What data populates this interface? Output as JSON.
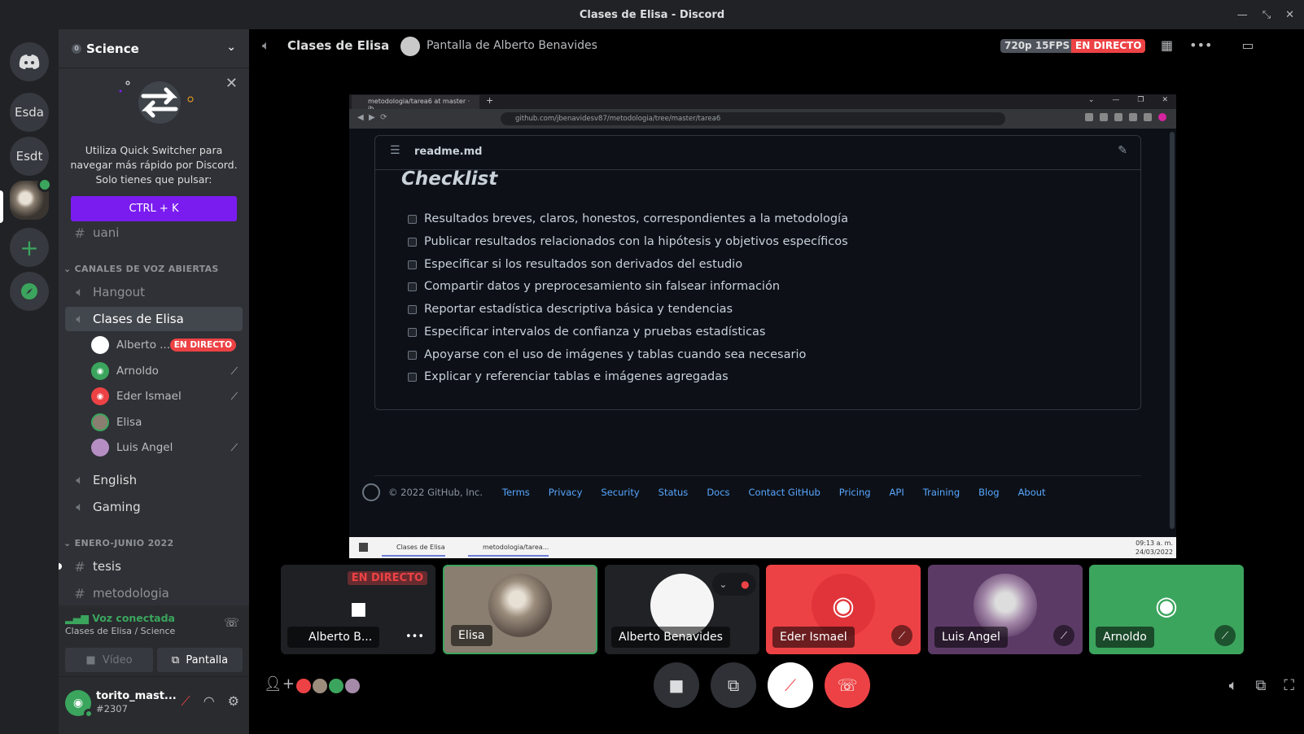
{
  "window": {
    "title": "Clases de Elisa - Discord"
  },
  "guilds": [
    {
      "label": "Esda"
    },
    {
      "label": "Esdt"
    }
  ],
  "server": {
    "name": "Science",
    "pin_count": "0"
  },
  "quick_switcher": {
    "text": "Utiliza Quick Switcher para navegar más rápido por Discord. Solo tienes que pulsar:",
    "button": "CTRL + K"
  },
  "channels": {
    "partial_top": "uani",
    "voice_category": "CANALES DE VOZ ABIERTAS",
    "voice": [
      {
        "name": "Hangout"
      },
      {
        "name": "Clases de Elisa"
      },
      {
        "name": "English"
      },
      {
        "name": "Gaming"
      }
    ],
    "voice_users": [
      {
        "name": "Alberto ...",
        "live": "EN DIRECTO"
      },
      {
        "name": "Arnoldo"
      },
      {
        "name": "Eder Ismael"
      },
      {
        "name": "Elisa"
      },
      {
        "name": "Luis Angel"
      }
    ],
    "text_category": "ENERO-JUNIO 2022",
    "text": [
      {
        "name": "tesis"
      },
      {
        "name": "metodologia"
      }
    ]
  },
  "voice_panel": {
    "status": "Voz conectada",
    "location": "Clases de Elisa / Science",
    "video": "Vídeo",
    "screen": "Pantalla"
  },
  "user": {
    "name": "torito_mast...",
    "tag": "#2307"
  },
  "header": {
    "channel": "Clases de Elisa",
    "screen_owner": "Pantalla de Alberto Benavides",
    "quality": "720p 15FPS",
    "live": "EN DIRECTO"
  },
  "stream": {
    "browser_tab": "metodologia/tarea6 at master · jb",
    "url": "github.com/jbenavidesv87/metodologia/tree/master/tarea6",
    "file_name": "readme.md",
    "heading": "Checklist",
    "checklist": [
      "Resultados breves, claros, honestos, correspondientes a la metodología",
      "Publicar resultados relacionados con la hipótesis y objetivos específicos",
      "Especificar si los resultados son derivados del estudio",
      "Compartir datos y preprocesamiento sin falsear información",
      "Reportar estadística descriptiva básica y tendencias",
      "Especificar intervalos de confianza y pruebas estadísticas",
      "Apoyarse con el uso de imágenes y tablas cuando sea necesario",
      "Explicar y referenciar tablas e imágenes agregadas"
    ],
    "footer_copy": "© 2022 GitHub, Inc.",
    "footer_links": [
      "Terms",
      "Privacy",
      "Security",
      "Status",
      "Docs",
      "Contact GitHub",
      "Pricing",
      "API",
      "Training",
      "Blog",
      "About"
    ],
    "taskbar_items": [
      "Clases de Elisa",
      "metodologia/tarea..."
    ],
    "time": "09:13 a. m.",
    "date": "24/03/2022"
  },
  "tiles": [
    {
      "name": "Alberto B...",
      "badge": "EN DIRECTO"
    },
    {
      "name": "Elisa"
    },
    {
      "name": "Alberto Benavides"
    },
    {
      "name": "Eder Ismael"
    },
    {
      "name": "Luis Angel"
    },
    {
      "name": "Arnoldo"
    }
  ],
  "colors": {
    "accent_purple": "#7a1cf0",
    "live_red": "#ed4245",
    "voice_green": "#3ba55d",
    "github_link": "#58a6ff"
  }
}
